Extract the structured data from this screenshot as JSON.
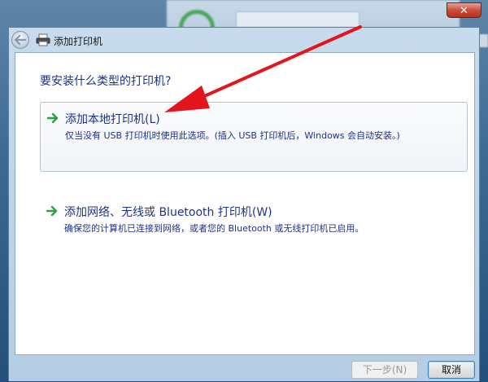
{
  "window": {
    "title": "添加打印机",
    "close_label": "✕"
  },
  "main": {
    "question": "要安装什么类型的打印机?",
    "options": [
      {
        "title": "添加本地打印机(L)",
        "description": "仅当没有 USB 打印机时使用此选项。(插入 USB 打印机后，Windows 会自动安装。)",
        "selected": true
      },
      {
        "title": "添加网络、无线或 Bluetooth 打印机(W)",
        "description": "确保您的计算机已连接到网络，或者您的 Bluetooth 或无线打印机已启用。",
        "selected": false
      }
    ]
  },
  "footer": {
    "next_label": "下一步(N)",
    "next_enabled": false,
    "cancel_label": "取消"
  },
  "colors": {
    "link_text": "#1e3287",
    "arrow_green": "#2ea043",
    "annotation_red": "#e3141b"
  },
  "icons": {
    "back": "back-arrow-icon",
    "printer": "printer-icon",
    "option_arrow": "green-arrow-icon"
  }
}
